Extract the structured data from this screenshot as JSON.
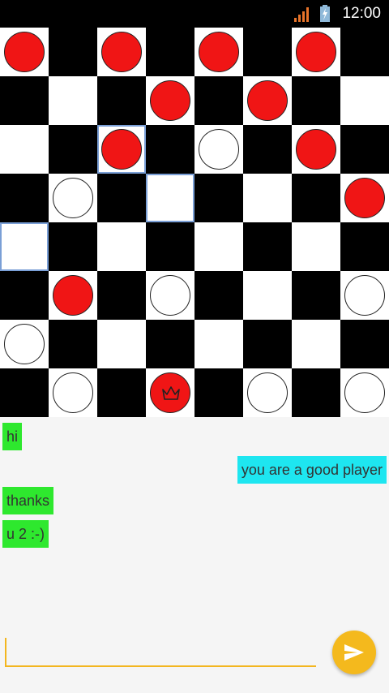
{
  "status_bar": {
    "time": "12:00",
    "signal_icon": "signal-icon",
    "battery_icon": "battery-charging-icon"
  },
  "board": {
    "size": 8,
    "colors": {
      "dark": "#000000",
      "light": "#ffffff",
      "red_piece": "#f01515",
      "white_piece": "#ffffff",
      "highlight": "#7a9fd6"
    },
    "pieces": [
      {
        "row": 0,
        "col": 0,
        "color": "red",
        "king": false
      },
      {
        "row": 0,
        "col": 2,
        "color": "red",
        "king": false
      },
      {
        "row": 0,
        "col": 4,
        "color": "red",
        "king": false
      },
      {
        "row": 0,
        "col": 6,
        "color": "red",
        "king": false
      },
      {
        "row": 1,
        "col": 3,
        "color": "red",
        "king": false
      },
      {
        "row": 1,
        "col": 5,
        "color": "red",
        "king": false
      },
      {
        "row": 2,
        "col": 2,
        "color": "red",
        "king": false
      },
      {
        "row": 2,
        "col": 4,
        "color": "white",
        "king": false
      },
      {
        "row": 2,
        "col": 6,
        "color": "red",
        "king": false
      },
      {
        "row": 3,
        "col": 1,
        "color": "white",
        "king": false
      },
      {
        "row": 3,
        "col": 7,
        "color": "red",
        "king": false
      },
      {
        "row": 5,
        "col": 1,
        "color": "red",
        "king": false
      },
      {
        "row": 5,
        "col": 3,
        "color": "white",
        "king": false
      },
      {
        "row": 5,
        "col": 7,
        "color": "white",
        "king": false
      },
      {
        "row": 6,
        "col": 0,
        "color": "white",
        "king": false
      },
      {
        "row": 7,
        "col": 1,
        "color": "white",
        "king": false
      },
      {
        "row": 7,
        "col": 3,
        "color": "red",
        "king": true
      },
      {
        "row": 7,
        "col": 5,
        "color": "white",
        "king": false
      },
      {
        "row": 7,
        "col": 7,
        "color": "white",
        "king": false
      }
    ],
    "highlighted": [
      {
        "row": 2,
        "col": 2
      },
      {
        "row": 3,
        "col": 3
      },
      {
        "row": 4,
        "col": 0
      }
    ]
  },
  "chat": {
    "messages": [
      {
        "text": "hi",
        "side": "left",
        "color": "#2ee82e"
      },
      {
        "text": "you are a good player",
        "side": "right",
        "color": "#1ee6f0"
      },
      {
        "text": "thanks",
        "side": "left",
        "color": "#2ee82e"
      },
      {
        "text": "u 2 :-)",
        "side": "left",
        "color": "#2ee82e"
      }
    ]
  },
  "composer": {
    "value": "",
    "accent": "#f4b91d",
    "send_icon": "send-icon"
  }
}
